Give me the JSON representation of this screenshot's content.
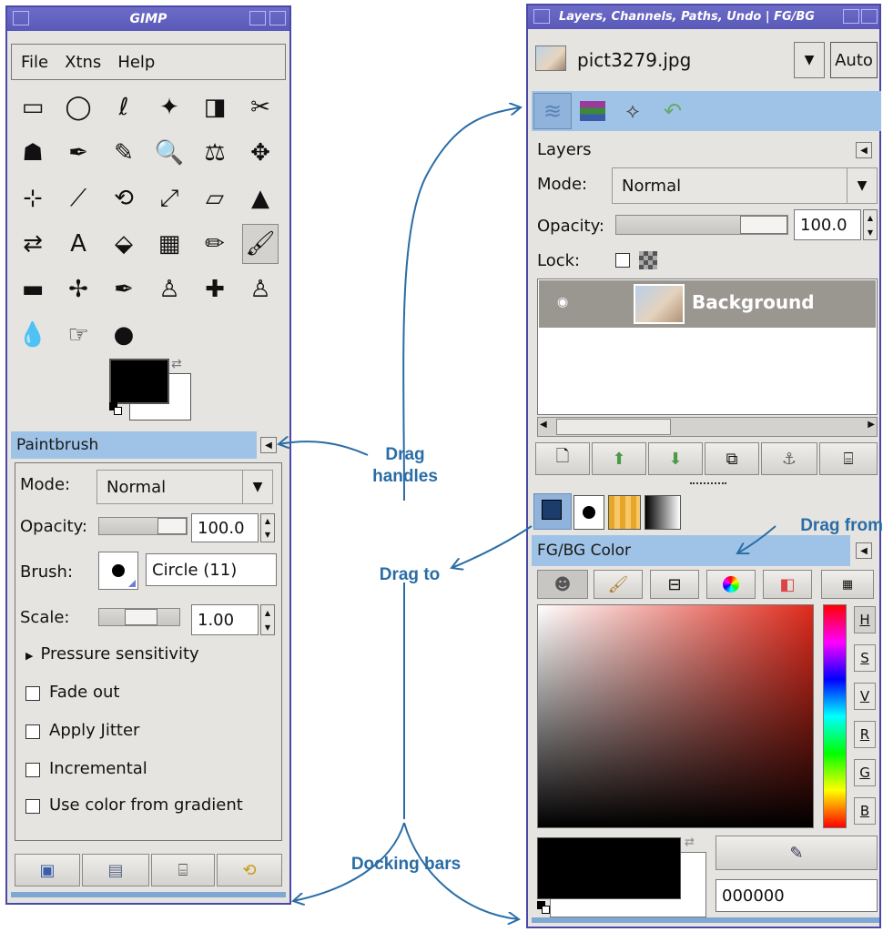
{
  "toolbox": {
    "title": "GIMP",
    "menu": [
      "File",
      "Xtns",
      "Help"
    ],
    "tools": [
      "rect-select-icon",
      "ellipse-select-icon",
      "lasso-icon",
      "fuzzy-select-icon",
      "color-select-icon",
      "scissors-icon",
      "foreground-select-icon",
      "paths-icon",
      "color-picker-icon",
      "zoom-icon",
      "measure-icon",
      "move-icon",
      "align-icon",
      "crop-icon",
      "rotate-icon",
      "scale-icon",
      "shear-icon",
      "perspective-icon",
      "flip-icon",
      "text-icon",
      "bucket-fill-icon",
      "blend-icon",
      "pencil-icon",
      "paintbrush-icon",
      "eraser-icon",
      "airbrush-icon",
      "ink-icon",
      "clone-icon",
      "heal-icon",
      "perspective-clone-icon",
      "blur-icon",
      "smudge-icon",
      "dodge-burn-icon"
    ],
    "tool_glyphs": [
      "▭",
      "◯",
      "ℓ",
      "✦",
      "◨",
      "✂",
      "☗",
      "✒",
      "✎",
      "🔍",
      "⚖",
      "✥",
      "⊹",
      "⟋",
      "⟲",
      "⤢",
      "▱",
      "▲",
      "⇄",
      "A",
      "⬙",
      "▦",
      "✏",
      "🖌",
      "▬",
      "✢",
      "✒",
      "♙",
      "✚",
      "♙",
      "💧",
      "☞",
      "●"
    ],
    "selected_tool_index": 23
  },
  "tool_options": {
    "tab_label": "Paintbrush",
    "mode_label": "Mode:",
    "mode_value": "Normal",
    "opacity_label": "Opacity:",
    "opacity_value": "100.0",
    "brush_label": "Brush:",
    "brush_value": "Circle (11)",
    "scale_label": "Scale:",
    "scale_value": "1.00",
    "pressure_label": "Pressure sensitivity",
    "checkboxes": [
      "Fade out",
      "Apply Jitter",
      "Incremental",
      "Use color from gradient"
    ]
  },
  "layers_dock": {
    "title": "Layers, Channels, Paths, Undo | FG/BG",
    "image_name": "pict3279.jpg",
    "auto_label": "Auto",
    "panel_title": "Layers",
    "mode_label": "Mode:",
    "mode_value": "Normal",
    "opacity_label": "Opacity:",
    "opacity_value": "100.0",
    "lock_label": "Lock:",
    "layer_name": "Background"
  },
  "fgbg_dock": {
    "panel_title": "FG/BG Color",
    "channel_buttons": [
      "H",
      "S",
      "V",
      "R",
      "G",
      "B"
    ],
    "hex_value": "000000"
  },
  "annotations": {
    "drag_handles": "Drag\nhandles",
    "drag_to": "Drag to",
    "drag_from": "Drag from",
    "docking_bars": "Docking bars"
  },
  "colors": {
    "title_bar": "#5a59b8",
    "tab_blue": "#9fc3e6",
    "annotation": "#2a6da6",
    "foreground": "#000000",
    "background": "#ffffff"
  }
}
